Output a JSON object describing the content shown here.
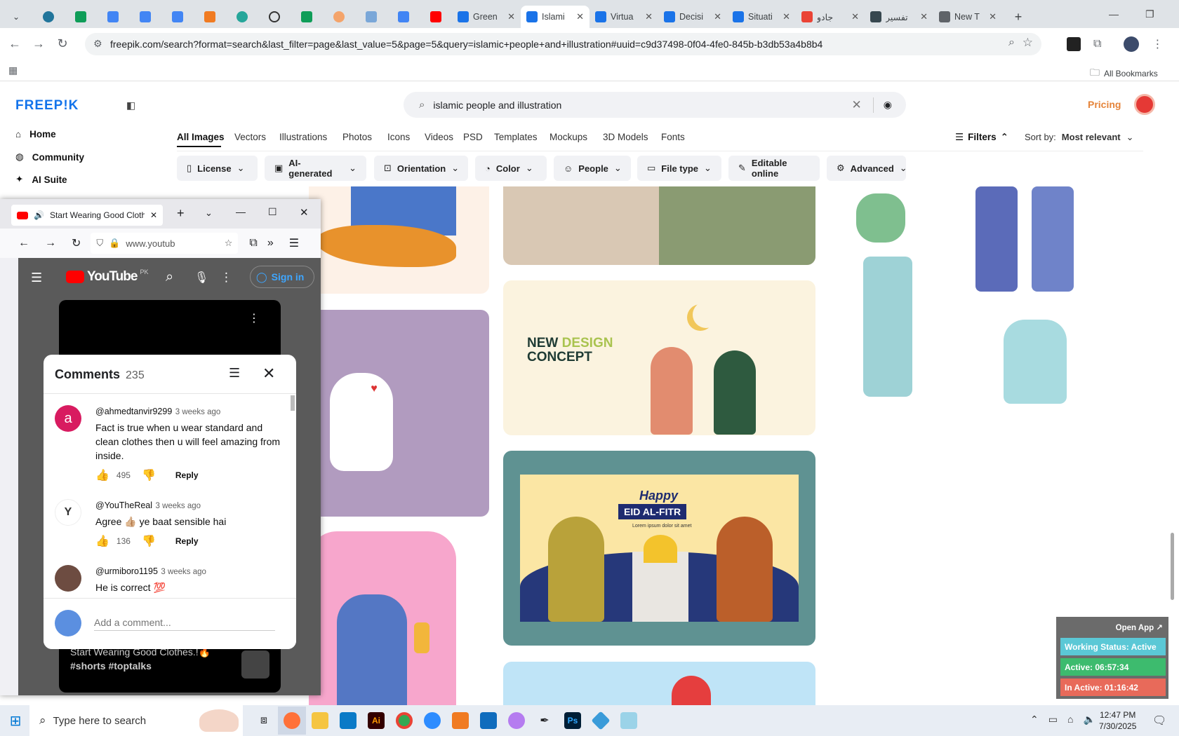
{
  "browser": {
    "tabs": [
      {
        "label": "Green",
        "color": "#1a73e8"
      },
      {
        "label": "Islami",
        "color": "#1a73e8"
      },
      {
        "label": "Virtua",
        "color": "#1a73e8"
      },
      {
        "label": "Decisi",
        "color": "#1a73e8"
      },
      {
        "label": "Situati",
        "color": "#1a73e8"
      },
      {
        "label": "جادو",
        "color": "#ea4335"
      },
      {
        "label": "تفسير",
        "color": "#37474f"
      },
      {
        "label": "New T",
        "color": "#5f6368"
      }
    ],
    "url": "freepik.com/search?format=search&last_filter=page&last_value=5&page=5&query=islamic+people+and+illustration#uuid=c9d37498-0f04-4fe0-845b-b3db53a4b8b4",
    "bookmarks_label": "All Bookmarks"
  },
  "freepik": {
    "logo": "FREEP!K",
    "nav": [
      "Home",
      "Community",
      "AI Suite"
    ],
    "search_query": "islamic people and illustration",
    "pricing": "Pricing",
    "type_tabs": [
      "All Images",
      "Vectors",
      "Illustrations",
      "Photos",
      "Icons",
      "Videos",
      "PSD",
      "Templates",
      "Mockups",
      "3D Models",
      "Fonts"
    ],
    "filters_label": "Filters",
    "sort_label": "Sort by:",
    "sort_value": "Most relevant",
    "chips": [
      "License",
      "AI-generated",
      "Orientation",
      "Color",
      "People",
      "File type",
      "Editable online",
      "Advanced"
    ],
    "card_texts": {
      "new_design_1": "NEW",
      "new_design_2": "DESIGN",
      "new_design_3": "CONCEPT",
      "happy": "Happy",
      "eid": "EID AL-FITR",
      "lorem": "Lorem ipsum dolor sit amet"
    }
  },
  "firefox": {
    "tab_title": "Start Wearing Good Clothe",
    "url": "www.youtub",
    "yt_logo": "YouTube",
    "yt_region": "PK",
    "sign_in": "Sign in",
    "video_title": "Start Wearing Good Clothes.!🔥",
    "video_tags": "#shorts #toptalks"
  },
  "comments": {
    "title": "Comments",
    "count": "235",
    "items": [
      {
        "user": "@ahmedtanvir9299",
        "time": "3 weeks ago",
        "text": "Fact is true when u wear standard and clean clothes then u will feel amazing from inside.",
        "likes": "495",
        "reply": "Reply",
        "avatar": "a",
        "avatar_color": "#d81b60"
      },
      {
        "user": "@YouTheReal",
        "time": "3 weeks ago",
        "text": "Agree 👍🏼 ye baat sensible hai",
        "likes": "136",
        "reply": "Reply",
        "avatar": "Y",
        "avatar_color": "#ffffff"
      },
      {
        "user": "@urmiboro1195",
        "time": "3 weeks ago",
        "text": "He is correct 💯",
        "avatar_color": "#6d4c41"
      }
    ],
    "add_placeholder": "Add a comment..."
  },
  "widget": {
    "open_app": "Open App ↗",
    "working_status": "Working Status: Active",
    "active": "Active: 06:57:34",
    "inactive": "In Active: 01:16:42",
    "colors": {
      "status": "#5bc8d6",
      "active": "#3dbb6e",
      "inactive": "#e86a5a"
    }
  },
  "taskbar": {
    "search_placeholder": "Type here to search",
    "time": "12:47 PM",
    "date": "7/30/2025"
  }
}
